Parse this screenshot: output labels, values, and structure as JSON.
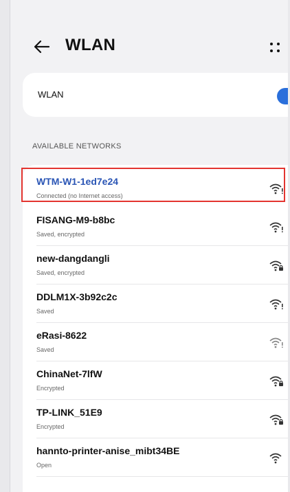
{
  "header": {
    "title": "WLAN",
    "back_icon": "back-arrow-icon",
    "more_icon": "more-dots-icon"
  },
  "wlan_toggle": {
    "label": "WLAN",
    "on": true,
    "accent_color": "#2a6fdb"
  },
  "section": {
    "available_label": "AVAILABLE NETWORKS"
  },
  "networks": [
    {
      "name": "WTM-W1-1ed7e24",
      "status": "Connected (no Internet access)",
      "icon": "wifi-alert-icon",
      "connected": true
    },
    {
      "name": "FISANG-M9-b8bc",
      "status": "Saved, encrypted",
      "icon": "wifi-alert-icon"
    },
    {
      "name": "new-dangdangli",
      "status": "Saved, encrypted",
      "icon": "wifi-lock-icon"
    },
    {
      "name": "DDLM1X-3b92c2c",
      "status": "Saved",
      "icon": "wifi-alert-icon"
    },
    {
      "name": "eRasi-8622",
      "status": "Saved",
      "icon": "wifi-alert-icon"
    },
    {
      "name": "ChinaNet-7lfW",
      "status": "Encrypted",
      "icon": "wifi-lock-icon"
    },
    {
      "name": "TP-LINK_51E9",
      "status": "Encrypted",
      "icon": "wifi-lock-icon"
    },
    {
      "name": "hannto-printer-anise_mibt34BE",
      "status": "Open",
      "icon": "wifi-icon"
    }
  ],
  "colors": {
    "connected_text": "#2a55b5",
    "highlight_border": "#e3342f"
  }
}
